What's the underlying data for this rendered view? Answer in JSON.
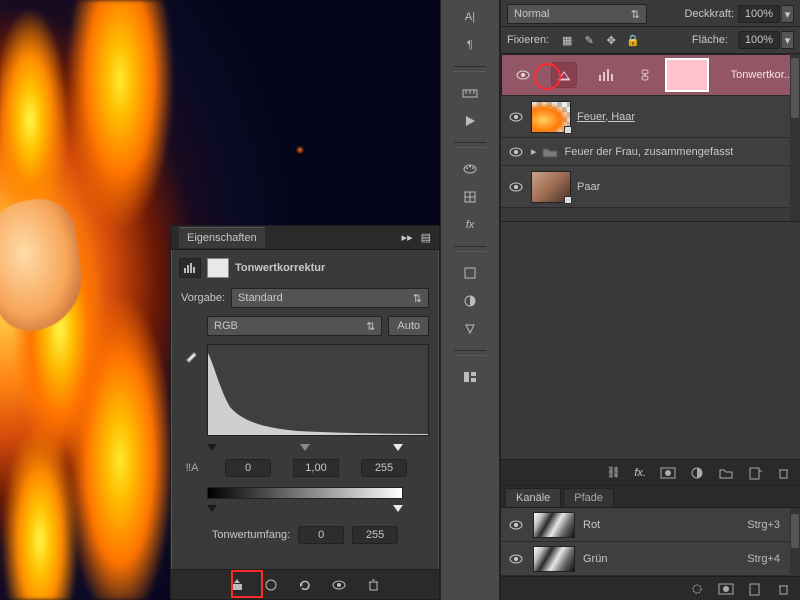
{
  "properties_panel": {
    "tab_label": "Eigenschaften",
    "adjustment_title": "Tonwertkorrektur",
    "preset_label": "Vorgabe:",
    "preset_value": "Standard",
    "channel_value": "RGB",
    "auto_label": "Auto",
    "input_black": "0",
    "input_gamma": "1,00",
    "input_white": "255",
    "output_label": "Tonwertumfang:",
    "output_black": "0",
    "output_white": "255"
  },
  "layers_panel": {
    "blend_mode": "Normal",
    "opacity_label": "Deckkraft:",
    "opacity_value": "100%",
    "fill_label": "Fläche:",
    "fill_value": "100%",
    "lock_label": "Fixieren:",
    "layers": [
      {
        "name": "Tonwertkor...",
        "selected": true,
        "type": "adjustment"
      },
      {
        "name": "Feuer, Haar ",
        "type": "image",
        "underline": true
      },
      {
        "name": "Feuer der Frau, zusammengefasst",
        "type": "group"
      },
      {
        "name": "Paar",
        "type": "image"
      }
    ]
  },
  "channels_panel": {
    "tabs": {
      "channels": "Kanäle",
      "paths": "Pfade"
    },
    "rows": [
      {
        "name": "Rot",
        "shortcut": "Strg+3"
      },
      {
        "name": "Grün",
        "shortcut": "Strg+4"
      }
    ]
  },
  "icons": {
    "clip": "◪",
    "levels": "▮",
    "eye": "👁"
  }
}
